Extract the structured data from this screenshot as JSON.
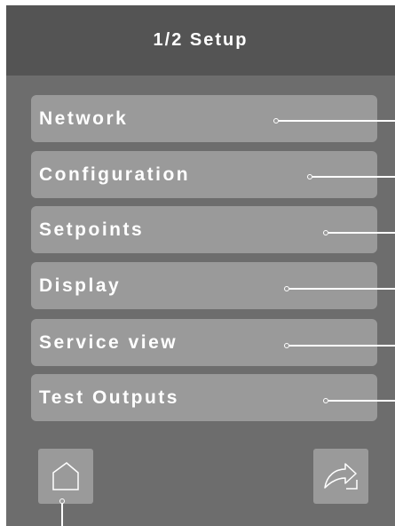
{
  "header": {
    "title": "1/2 Setup"
  },
  "menu": {
    "items": [
      {
        "label": "Network"
      },
      {
        "label": "Configuration"
      },
      {
        "label": "Setpoints"
      },
      {
        "label": "Display"
      },
      {
        "label": "Service view"
      },
      {
        "label": "Test Outputs"
      }
    ]
  },
  "footer": {
    "home_icon": "home-icon",
    "next_page_icon": "curved-arrow-icon"
  },
  "colors": {
    "background": "#6d6d6d",
    "header": "#545454",
    "button": "#9a9a9a",
    "text": "#ffffff"
  }
}
